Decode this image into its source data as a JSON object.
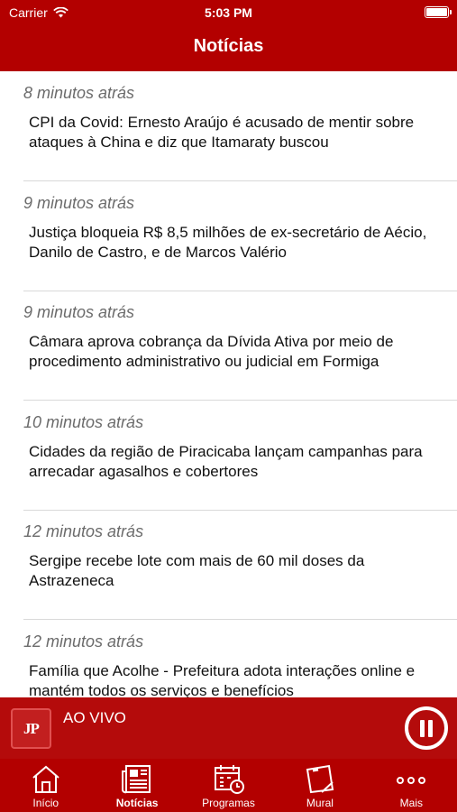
{
  "status_bar": {
    "carrier": "Carrier",
    "time": "5:03 PM"
  },
  "header": {
    "title": "Notícias"
  },
  "news": [
    {
      "time": "8 minutos atrás",
      "title": "CPI da Covid: Ernesto Araújo é acusado de mentir sobre ataques à China e diz que Itamaraty buscou"
    },
    {
      "time": "9 minutos atrás",
      "title": "Justiça bloqueia R$ 8,5 milhões de ex-secretário de Aécio, Danilo de Castro, e de Marcos Valério"
    },
    {
      "time": "9 minutos atrás",
      "title": "Câmara aprova cobrança da Dívida Ativa por meio de procedimento administrativo ou judicial em Formiga"
    },
    {
      "time": "10 minutos atrás",
      "title": "Cidades da região de Piracicaba lançam campanhas para arrecadar agasalhos e cobertores"
    },
    {
      "time": "12 minutos atrás",
      "title": "Sergipe recebe lote com mais de 60 mil doses da Astrazeneca"
    },
    {
      "time": "12 minutos atrás",
      "title": "Família que Acolhe - Prefeitura adota interações online e mantém todos os serviços e benefícios"
    }
  ],
  "live": {
    "logo_text": "JP",
    "label": "AO VIVO"
  },
  "tabs": [
    {
      "label": "Início",
      "icon": "home-icon"
    },
    {
      "label": "Notícias",
      "icon": "newspaper-icon"
    },
    {
      "label": "Programas",
      "icon": "schedule-icon"
    },
    {
      "label": "Mural",
      "icon": "mural-icon"
    },
    {
      "label": "Mais",
      "icon": "more-icon"
    }
  ],
  "colors": {
    "brand": "#b30000",
    "live_bar": "#b40b0b",
    "time_text": "#6b6b6b"
  }
}
